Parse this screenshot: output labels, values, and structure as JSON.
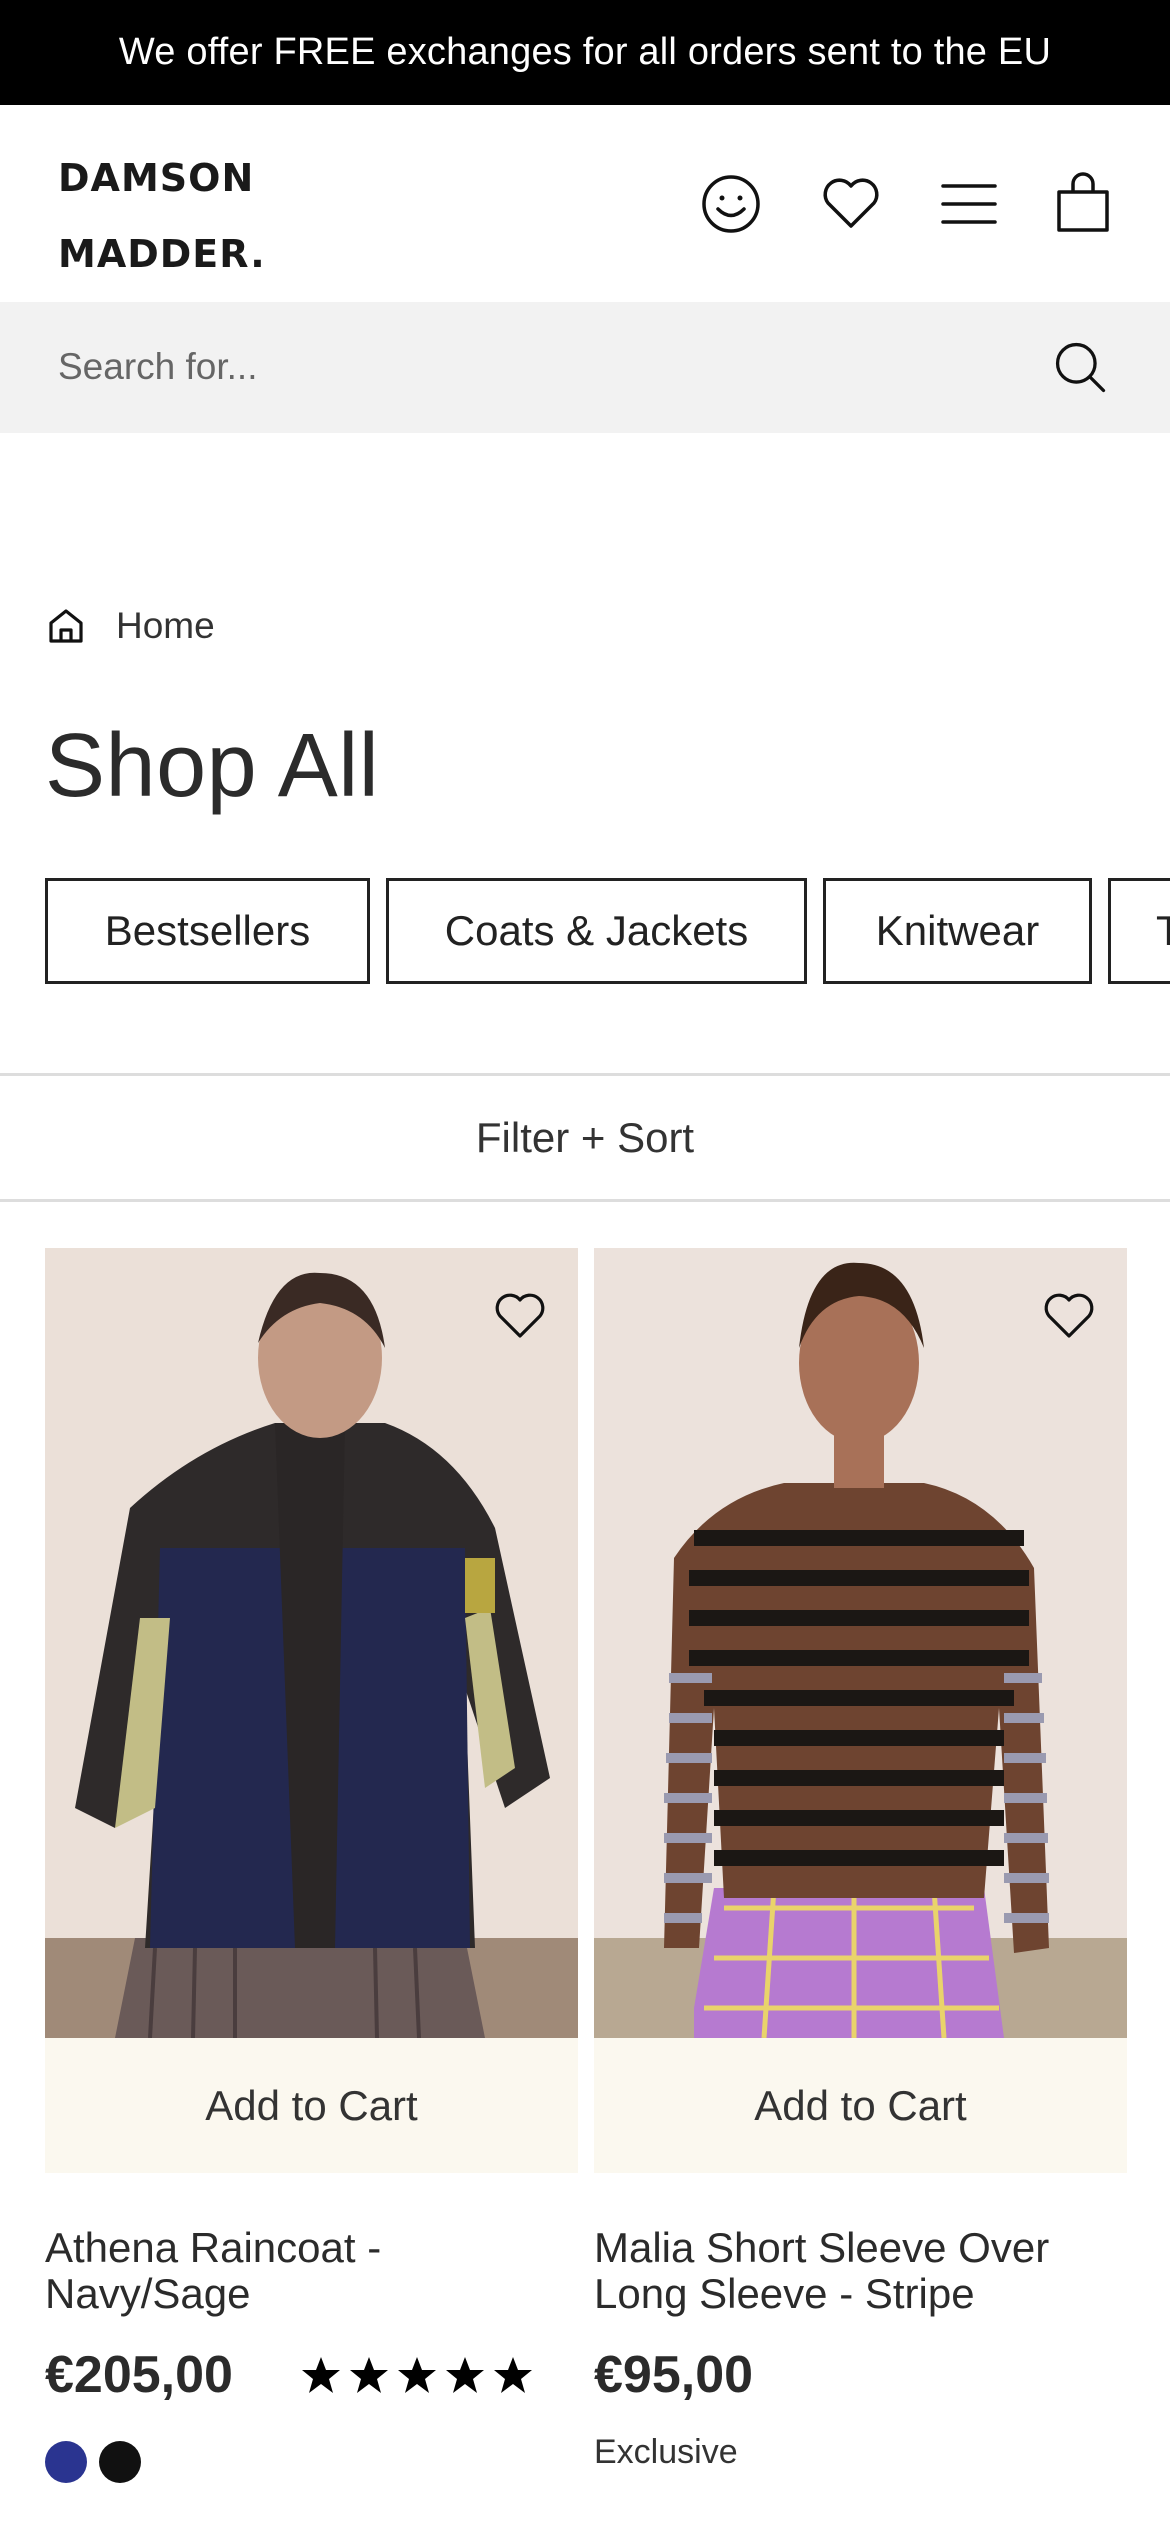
{
  "announcement": "We offer FREE exchanges for all orders sent to the EU",
  "brand": {
    "line1": "DAMSON",
    "line2": "MADDER."
  },
  "header_icons": [
    "account-icon",
    "heart-icon",
    "menu-icon",
    "bag-icon"
  ],
  "search": {
    "placeholder": "Search for..."
  },
  "breadcrumb": {
    "home": "Home"
  },
  "page_title": "Shop All",
  "categories": [
    "Bestsellers",
    "Coats & Jackets",
    "Knitwear",
    "T"
  ],
  "filter_label": "Filter + Sort",
  "products": [
    {
      "add_to_cart": "Add to Cart",
      "name": "Athena Raincoat - Navy/Sage",
      "price": "€205,00",
      "rating_stars": 5,
      "swatches": [
        "#2a3490",
        "#111111"
      ]
    },
    {
      "add_to_cart": "Add to Cart",
      "name": "Malia Short Sleeve Over Long Sleeve - Stripe",
      "price": "€95,00",
      "badge": "Exclusive"
    }
  ]
}
